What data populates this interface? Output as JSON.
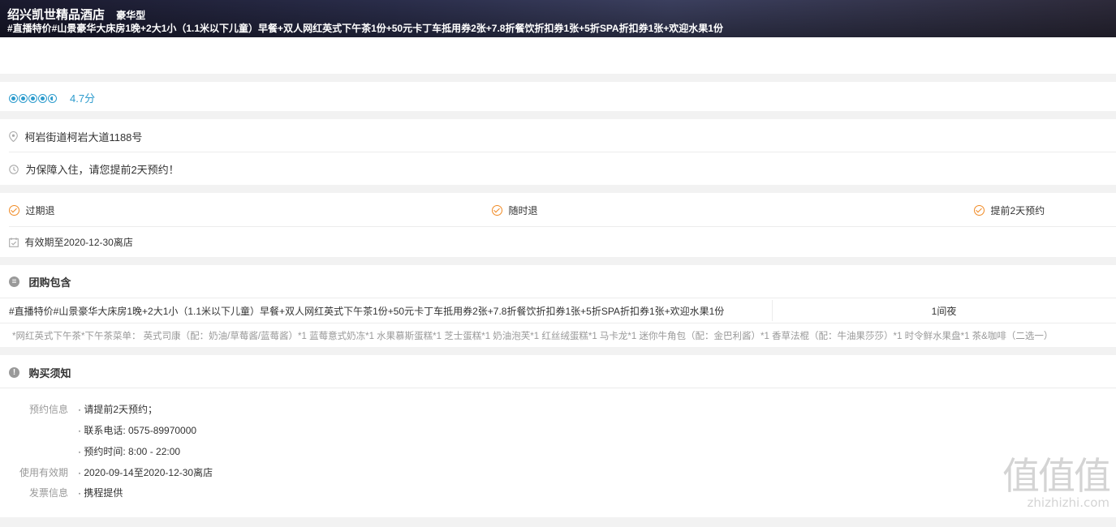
{
  "header": {
    "hotel_name": "绍兴凯世精品酒店",
    "room_type": "豪华型",
    "deal_title": "#直播特价#山景豪华大床房1晚+2大1小（1.1米以下儿童）早餐+双人网红英式下午茶1份+50元卡丁车抵用券2张+7.8折餐饮折扣券1张+5折SPA折扣券1张+欢迎水果1份"
  },
  "rating": {
    "stars": 4.5,
    "score_text": "4.7分"
  },
  "info": {
    "address": "柯岩街道柯岩大道1188号",
    "booking_tip": "为保障入住，请您提前2天预约！"
  },
  "policies": {
    "items": [
      "过期退",
      "随时退",
      "提前2天预约"
    ],
    "validity": "有效期至2020-12-30离店"
  },
  "package": {
    "section_title": "团购包含",
    "item_name": "#直播特价#山景豪华大床房1晚+2大1小（1.1米以下儿童）早餐+双人网红英式下午茶1份+50元卡丁车抵用券2张+7.8折餐饮折扣券1张+5折SPA折扣券1张+欢迎水果1份",
    "item_qty": "1间夜",
    "note": "*网红英式下午茶*下午茶菜单： 英式司康（配：奶油/草莓酱/蓝莓酱）*1 蓝莓意式奶冻*1 水果慕斯蛋糕*1 芝士蛋糕*1 奶油泡芙*1 红丝绒蛋糕*1 马卡龙*1 迷你牛角包（配：金巴利酱）*1 香草法棍（配：牛油果莎莎）*1 时令鲜水果盘*1 茶&咖啡（二选一）"
  },
  "notice": {
    "section_title": "购买须知",
    "booking_label": "预约信息",
    "booking_lines": [
      "· 请提前2天预约；",
      "· 联系电话: 0575-89970000",
      "· 预约时间: 8:00 - 22:00"
    ],
    "validity_label": "使用有效期",
    "validity_value": "· 2020-09-14至2020-12-30离店",
    "invoice_label": "发票信息",
    "invoice_value": "· 携程提供"
  },
  "watermark": {
    "glyphs": "值值值",
    "site": "zhizhizhi.com"
  },
  "colors": {
    "accent_blue": "#2d9bcd",
    "accent_orange": "#f08a24"
  }
}
